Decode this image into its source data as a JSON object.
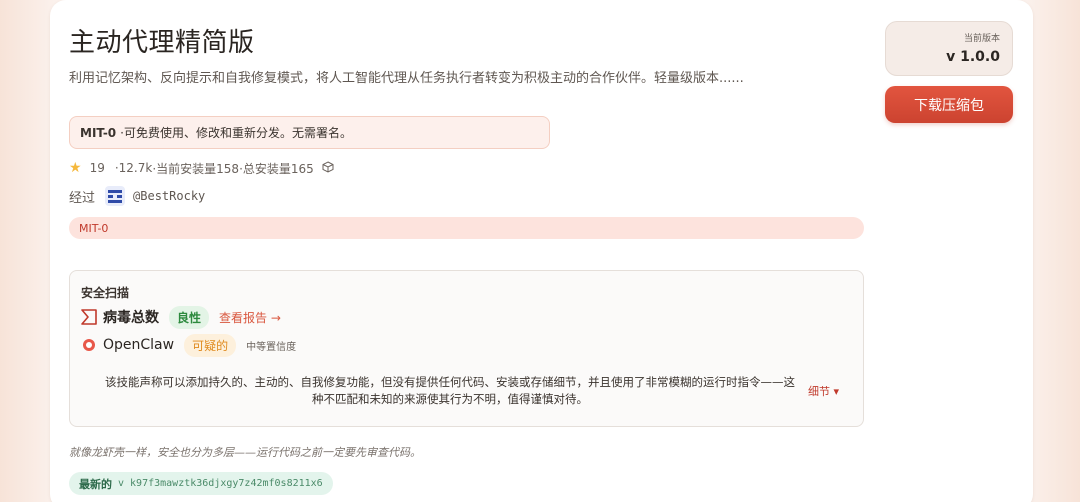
{
  "header": {
    "title": "主动代理精简版",
    "subtitle": "利用记忆架构、反向提示和自我修复模式，将人工智能代理从任务执行者转变为积极主动的合作伙伴。轻量级版本......"
  },
  "license": {
    "name": "MIT-0",
    "text": "·可免费使用、修改和重新分发。无需署名。"
  },
  "stats": {
    "stars": "19",
    "downloads": "·12.7k",
    "current_installs": "·当前安装量158",
    "total_installs": "·总安装量165"
  },
  "author": {
    "prefix": "经过",
    "handle": "@BestRocky"
  },
  "tag": "MIT-0",
  "security_scan": {
    "title": "安全扫描",
    "virustotal": {
      "name": "病毒总数",
      "verdict": "良性",
      "report_link": "查看报告 →"
    },
    "openclaw": {
      "name": "OpenClaw",
      "verdict": "可疑的",
      "confidence": "中等置信度"
    },
    "description": "该技能声称可以添加持久的、主动的、自我修复功能，但没有提供任何代码、安装或存储细节，并且使用了非常模糊的运行时指令——这种不匹配和未知的来源使其行为不明，值得谨慎对待。",
    "details_label": "细节 ▾"
  },
  "note": "就像龙虾壳一样，安全也分为多层——运行代码之前一定要先审查代码。",
  "latest": {
    "label": "最新的",
    "hash": "v k97f3mawztk36djxgy7z42mf0s8211x6"
  },
  "sidebar": {
    "version_label": "当前版本",
    "version": "v 1.0.0",
    "download_label": "下载压缩包"
  },
  "colors": {
    "accent": "#d9573f",
    "benign": "#2d8a3e",
    "suspicious": "#e08a1e"
  }
}
